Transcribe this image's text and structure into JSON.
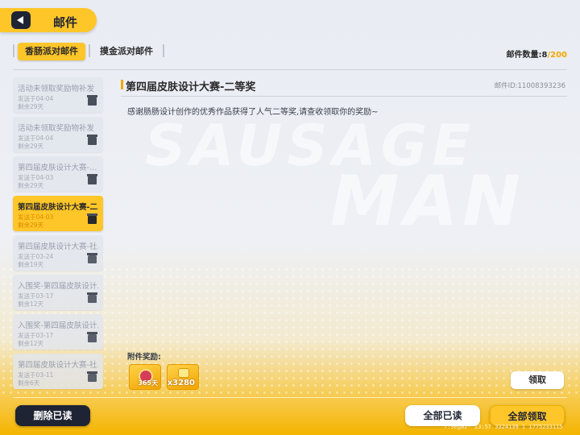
{
  "header": {
    "title": "邮件"
  },
  "watermark": {
    "line1": "SAUSAGE",
    "line2": "MAN"
  },
  "tabs": [
    {
      "label": "香肠派对邮件",
      "active": true
    },
    {
      "label": "摸金派对邮件",
      "active": false
    }
  ],
  "mail_count": {
    "label": "邮件数量:",
    "current": "8",
    "max": "/200"
  },
  "mails": [
    {
      "title": "活动未领取奖励物补发",
      "date": "发送于04-04",
      "remaining": "剩余29天",
      "icon": "gift-icon",
      "active": false
    },
    {
      "title": "活动未领取奖励物补发",
      "date": "发送于04-04",
      "remaining": "剩余29天",
      "icon": "gift-icon",
      "active": false
    },
    {
      "title": "第四届皮肤设计大赛-…",
      "date": "发送于04-03",
      "remaining": "剩余29天",
      "icon": "gift-icon",
      "active": false
    },
    {
      "title": "第四届皮肤设计大赛-二…",
      "date": "发送于04-03",
      "remaining": "剩余29天",
      "icon": "gift-icon",
      "active": true
    },
    {
      "title": "第四届皮肤设计大赛-社…",
      "date": "发送于03-24",
      "remaining": "剩余19天",
      "icon": "opened-gift-icon",
      "active": false
    },
    {
      "title": "入围奖-第四届皮肤设计…",
      "date": "发送于03-17",
      "remaining": "剩余12天",
      "icon": "opened-gift-icon",
      "active": false
    },
    {
      "title": "入围奖-第四届皮肤设计…",
      "date": "发送于03-17",
      "remaining": "剩余12天",
      "icon": "opened-gift-icon",
      "active": false
    },
    {
      "title": "第四届皮肤设计大赛-社…",
      "date": "发送于03-11",
      "remaining": "剩余6天",
      "icon": "opened-gift-icon",
      "active": false
    }
  ],
  "detail": {
    "title": "第四届皮肤设计大赛-二等奖",
    "mail_id": "邮件ID:11008393236",
    "body": "感谢肠肠设计创作的优秀作品获得了人气二等奖,请查收领取你的奖励~",
    "attachments_label": "附件奖励:",
    "rewards": [
      {
        "icon": "badge-icon",
        "qty": "365天"
      },
      {
        "icon": "coin-icon",
        "qty": "x3280"
      }
    ],
    "claim_label": "领取"
  },
  "bottom": {
    "delete_read": "删除已读",
    "read_all": "全部已读",
    "claim_all": "全部领取"
  },
  "debug": "T:Seg8z- 23:57 3324139 1 1775233115"
}
